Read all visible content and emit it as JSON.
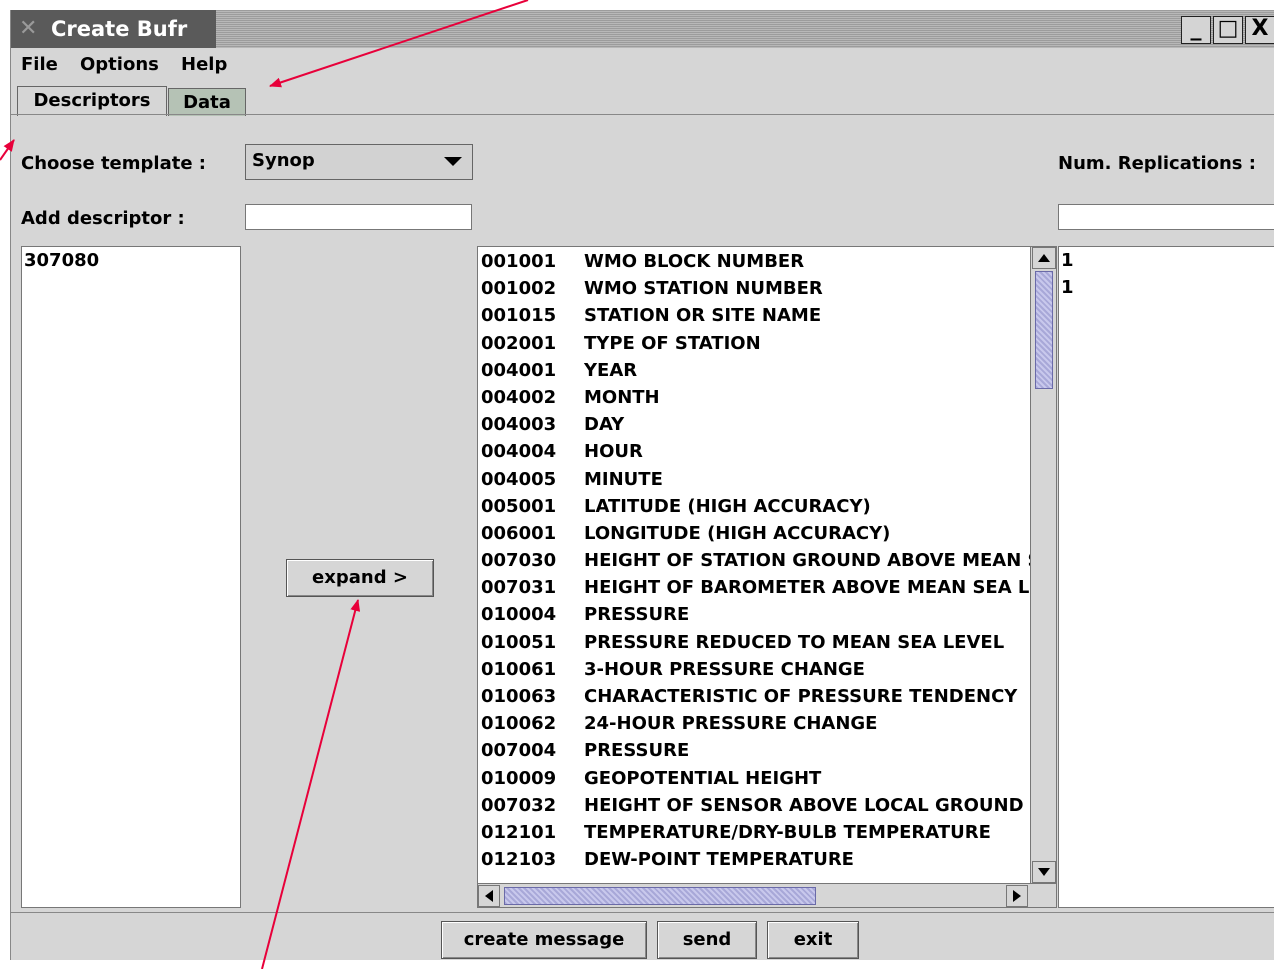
{
  "window": {
    "title": "Create Bufr",
    "controls": {
      "minimize": "_",
      "maximize": "□",
      "close": "X"
    }
  },
  "menubar": {
    "items": [
      "File",
      "Options",
      "Help"
    ]
  },
  "tabs": [
    {
      "label": "Descriptors",
      "active": true
    },
    {
      "label": "Data",
      "active": false
    }
  ],
  "form": {
    "choose_template_label": "Choose template :",
    "template_selected": "Synop",
    "add_descriptor_label": "Add descriptor :",
    "add_descriptor_value": "",
    "num_replications_label": "Num. Replications :",
    "num_replications_value": ""
  },
  "left_list": {
    "items": [
      "307080"
    ]
  },
  "expand_button": "expand >",
  "descriptors": [
    {
      "code": "001001",
      "name": "WMO BLOCK NUMBER"
    },
    {
      "code": "001002",
      "name": "WMO STATION NUMBER"
    },
    {
      "code": "001015",
      "name": "STATION OR SITE NAME"
    },
    {
      "code": "002001",
      "name": "TYPE OF STATION"
    },
    {
      "code": "004001",
      "name": "YEAR"
    },
    {
      "code": "004002",
      "name": "MONTH"
    },
    {
      "code": "004003",
      "name": "DAY"
    },
    {
      "code": "004004",
      "name": "HOUR"
    },
    {
      "code": "004005",
      "name": "MINUTE"
    },
    {
      "code": "005001",
      "name": "LATITUDE (HIGH ACCURACY)"
    },
    {
      "code": "006001",
      "name": "LONGITUDE (HIGH ACCURACY)"
    },
    {
      "code": "007030",
      "name": "HEIGHT OF STATION GROUND ABOVE MEAN S"
    },
    {
      "code": "007031",
      "name": "HEIGHT OF BAROMETER ABOVE MEAN SEA LE"
    },
    {
      "code": "010004",
      "name": "PRESSURE"
    },
    {
      "code": "010051",
      "name": "PRESSURE REDUCED TO MEAN SEA LEVEL"
    },
    {
      "code": "010061",
      "name": "3-HOUR PRESSURE CHANGE"
    },
    {
      "code": "010063",
      "name": "CHARACTERISTIC OF PRESSURE TENDENCY"
    },
    {
      "code": "010062",
      "name": "24-HOUR PRESSURE CHANGE"
    },
    {
      "code": "007004",
      "name": "PRESSURE"
    },
    {
      "code": "010009",
      "name": "GEOPOTENTIAL HEIGHT"
    },
    {
      "code": "007032",
      "name": "HEIGHT OF SENSOR ABOVE LOCAL GROUND ("
    },
    {
      "code": "012101",
      "name": "TEMPERATURE/DRY-BULB TEMPERATURE"
    },
    {
      "code": "012103",
      "name": "DEW-POINT TEMPERATURE"
    }
  ],
  "replications": {
    "items": [
      "1",
      "1"
    ]
  },
  "bottom_buttons": {
    "create": "create message",
    "send": "send",
    "exit": "exit"
  },
  "colors": {
    "annotation_arrow": "#e8003a",
    "scroll_thumb": "#b8b8e0",
    "inactive_tab": "#b5c2b5"
  }
}
